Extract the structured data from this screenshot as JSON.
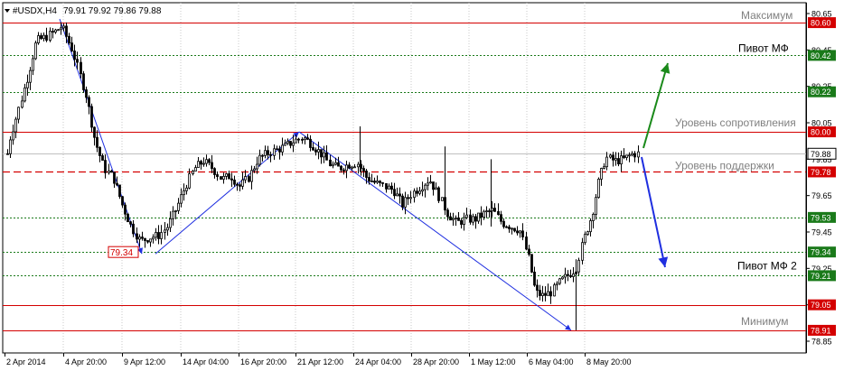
{
  "header": {
    "symbol": "#USDX,H4",
    "quote": "79.91 79.92 79.86 79.88",
    "menu_icon": "triangle-down-icon"
  },
  "chart_data": {
    "type": "candlestick",
    "ylim": [
      78.85,
      80.65
    ],
    "price_axis_ticks": [
      "80.65",
      "80.45",
      "80.25",
      "80.05",
      "79.85",
      "79.65",
      "79.45",
      "79.25",
      "79.05",
      "78.85"
    ],
    "time_axis_labels": [
      "2 Apr 2014",
      "4 Apr 20:00",
      "9 Apr 12:00",
      "14 Apr 04:00",
      "16 Apr 20:00",
      "21 Apr 12:00",
      "24 Apr 04:00",
      "28 Apr 20:00",
      "1 May 12:00",
      "6 May 04:00",
      "8 May 20:00"
    ],
    "levels": [
      {
        "value": 80.6,
        "label_value": "80.60",
        "kind": "solid",
        "color": "#d40000",
        "badge": "#d40000",
        "text": "Максимум"
      },
      {
        "value": 80.42,
        "label_value": "80.42",
        "kind": "dotted",
        "color": "#1a7a1a",
        "badge": "#1a7a1a",
        "text": "Пивот МФ"
      },
      {
        "value": 80.22,
        "label_value": "80.22",
        "kind": "dotted",
        "color": "#1a7a1a",
        "badge": "#1a7a1a",
        "text": ""
      },
      {
        "value": 80.0,
        "label_value": "80.00",
        "kind": "solid",
        "color": "#d40000",
        "badge": "#d40000",
        "text": "Уровень сопротивления"
      },
      {
        "value": 79.78,
        "label_value": "79.78",
        "kind": "dashed",
        "color": "#d40000",
        "badge": "#d40000",
        "text": "Уровень поддержки"
      },
      {
        "value": 79.53,
        "label_value": "79.53",
        "kind": "dotted",
        "color": "#1a7a1a",
        "badge": "#1a7a1a",
        "text": ""
      },
      {
        "value": 79.34,
        "label_value": "79.34",
        "kind": "dotted",
        "color": "#1a7a1a",
        "badge": "#1a7a1a",
        "text": ""
      },
      {
        "value": 79.21,
        "label_value": "79.21",
        "kind": "dotted",
        "color": "#1a7a1a",
        "badge": "#1a7a1a",
        "text": "Пивот МФ 2"
      },
      {
        "value": 79.05,
        "label_value": "79.05",
        "kind": "solid",
        "color": "#d40000",
        "badge": "#d40000",
        "text": ""
      },
      {
        "value": 78.91,
        "label_value": "78.91",
        "kind": "solid",
        "color": "#d40000",
        "badge": "#d40000",
        "text": "Минимум"
      }
    ],
    "current_price": {
      "value": 79.88,
      "label": "79.88"
    },
    "low_marker": {
      "label": "79.34"
    },
    "colors": {
      "candle": "#000000",
      "wave_lines": "#1f2fe0",
      "arrow_up": "#1a8a1a",
      "arrow_down": "#1f2fe0",
      "annotation_text": "#808080",
      "annotation_dark": "#000000"
    }
  }
}
